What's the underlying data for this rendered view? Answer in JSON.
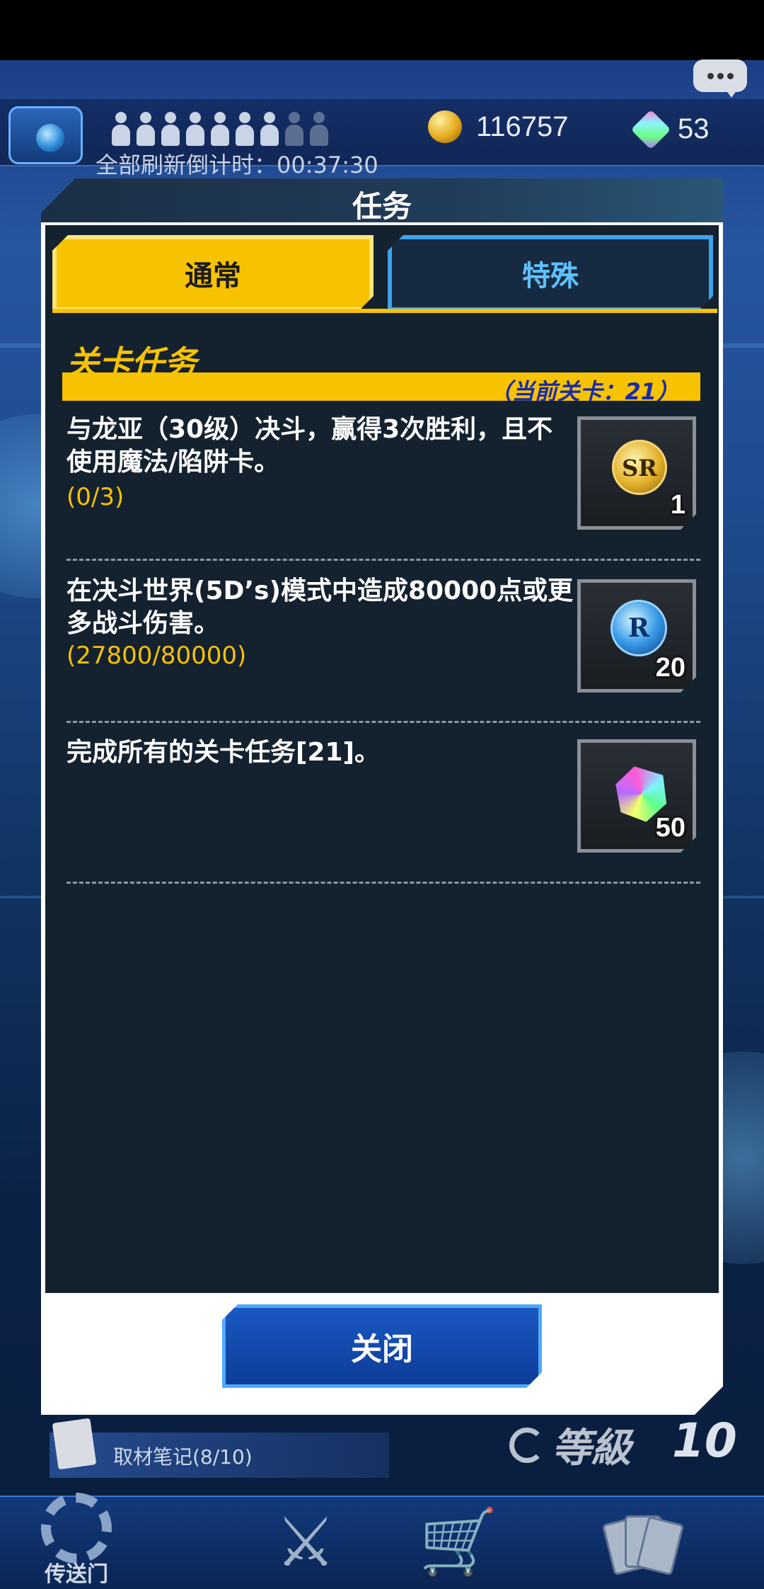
{
  "header": {
    "currency": {
      "gold": "116757",
      "gems": "53"
    },
    "countdown": "全部刷新倒计时：00:37:30"
  },
  "modal": {
    "title": "任务",
    "tabs": [
      {
        "label": "通常",
        "active": true
      },
      {
        "label": "特殊",
        "active": false
      }
    ],
    "section_title": "关卡任务",
    "current_stage": "（当前关卡：21）",
    "missions": [
      {
        "text": "与龙亚（30级）决斗，赢得3次胜利，且不使用魔法/陷阱卡。",
        "progress": "(0/3)",
        "reward_icon": "sr-ticket-icon",
        "reward_label": "SR",
        "reward_count": "1"
      },
      {
        "text": "在决斗世界(5D’s)模式中造成80000点或更多战斗伤害。",
        "progress": "(27800/80000)",
        "reward_icon": "r-ticket-icon",
        "reward_label": "R",
        "reward_count": "20"
      },
      {
        "text": "完成所有的关卡任务[21]。",
        "progress": "",
        "reward_icon": "gem-icon",
        "reward_label": "",
        "reward_count": "50"
      }
    ],
    "close_label": "关闭"
  },
  "bottom": {
    "notes": "取材笔记(8/10)",
    "level_label": "等級",
    "level_value": "10",
    "nav": [
      {
        "label": "传送门",
        "icon": "gear-icon"
      },
      {
        "label": "",
        "icon": "swords-icon"
      },
      {
        "label": "",
        "icon": "cart-icon"
      },
      {
        "label": "",
        "icon": "cards-icon"
      }
    ]
  },
  "colors": {
    "accent_yellow": "#f7c200",
    "tab_blue": "#3da3ea",
    "panel_bg": "#14212f",
    "button_blue": "#1a58c2"
  }
}
